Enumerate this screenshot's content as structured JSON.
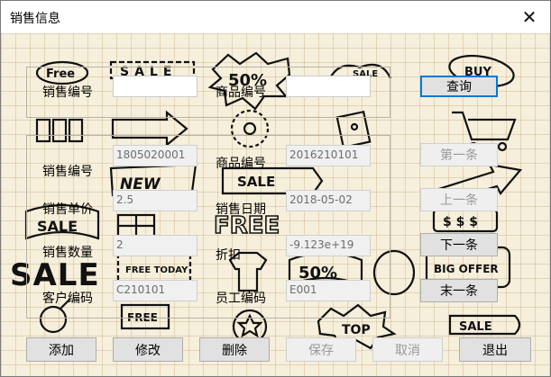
{
  "window": {
    "title": "销售信息",
    "close_glyph": "✕"
  },
  "search": {
    "sale_no_label": "销售编号",
    "sale_no_value": "",
    "product_no_label": "商品编号",
    "product_no_value": "",
    "query_button": "查询"
  },
  "record": {
    "sale_no_label": "销售编号",
    "sale_no_value": "1805020001",
    "product_no_label": "商品编号",
    "product_no_value": "2016210101",
    "unit_price_label": "销售单价",
    "unit_price_value": "2.5",
    "sale_date_label": "销售日期",
    "sale_date_value": "2018-05-02",
    "quantity_label": "销售数量",
    "quantity_value": "2",
    "discount_label": "折扣",
    "discount_value": "-9.123e+19",
    "customer_no_label": "客户编码",
    "customer_no_value": "C210101",
    "employee_no_label": "员工编码",
    "employee_no_value": "E001"
  },
  "nav": {
    "first": "第一条",
    "prev": "上一条",
    "next": "下一条",
    "last": "末一条"
  },
  "actions": {
    "add": "添加",
    "edit": "修改",
    "delete": "删除",
    "save": "保存",
    "cancel": "取消",
    "exit": "退出"
  },
  "background": {
    "stickers": [
      "Free",
      "SALE",
      "50%",
      "SALE",
      "NEW",
      "SALE",
      "FREE",
      "SALE",
      "FREE TODAY",
      "SALE",
      "50%",
      "BIG OFFER",
      "FREE",
      "SALE",
      "TOP",
      "SALE",
      "BUY"
    ]
  }
}
